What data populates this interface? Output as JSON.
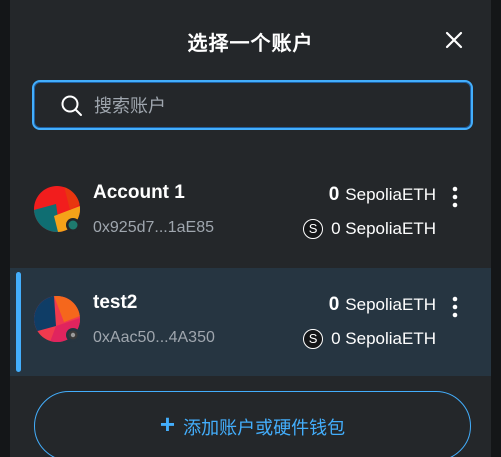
{
  "modal": {
    "title": "选择一个账户",
    "close_icon": "close-icon"
  },
  "search": {
    "placeholder": "搜索账户",
    "value": "",
    "icon": "search-icon"
  },
  "accounts": [
    {
      "name": "Account 1",
      "address": "0x925d7...1aE85",
      "balance_amount": "0",
      "balance_unit": "SepoliaETH",
      "token_symbol": "S",
      "secondary_balance": "0 SepoliaETH",
      "selected": false
    },
    {
      "name": "test2",
      "address": "0xAac50...4A350",
      "balance_amount": "0",
      "balance_unit": "SepoliaETH",
      "token_symbol": "S",
      "secondary_balance": "0 SepoliaETH",
      "selected": true
    }
  ],
  "add_button": {
    "icon": "plus-icon",
    "label": "添加账户或硬件钱包"
  },
  "colors": {
    "accent": "#43aefc",
    "background": "#24272a",
    "selected_row": "#263541",
    "muted_text": "#9fa6ae"
  }
}
